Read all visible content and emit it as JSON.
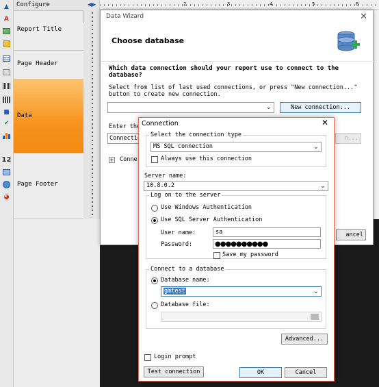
{
  "designer": {
    "configure_label": "Configure",
    "bands": [
      "Report Title",
      "Page Header",
      "Data",
      "Page Footer"
    ],
    "tools": [
      "pointer-icon",
      "text-icon",
      "picture-icon",
      "shape-icon",
      "table-icon",
      "image-icon",
      "barcode-icon",
      "check-icon",
      "chart-icon"
    ],
    "number_label": "12",
    "ruler_marks": [
      "1",
      "2",
      "3",
      "4",
      "5",
      "6"
    ]
  },
  "wizard": {
    "title": "Data Wizard",
    "close_glyph": "✕",
    "header": "Choose database",
    "question": "Which data connection should your report use to connect to the database?",
    "select_text": "Select from list of last used connections, or press \"New connection...\" button to create new connection.",
    "new_connection_label": "New connection...",
    "enter_text": "Enter the",
    "conn_field_value": "Connectio",
    "ghost_button_label": "n...",
    "conn_tree_label": "Conne",
    "cancel_label": "ancel"
  },
  "connection": {
    "title": "Connection",
    "close_glyph": "✕",
    "type_group_label": "Select the connection type",
    "type_value": "MS SQL connection",
    "always_use_label": "Always use this connection",
    "server_name_label": "Server name:",
    "server_name_value": "10.8.0.2",
    "logon_group_label": "Log on to the server",
    "windows_auth_label": "Use Windows Authentication",
    "sql_auth_label": "Use SQL Server Authentication",
    "username_label": "User name:",
    "username_value": "sa",
    "password_label": "Password:",
    "password_mask": "●●●●●●●●●●",
    "save_password_label": "Save my password",
    "db_group_label": "Connect to a database",
    "db_name_radio_label": "Database name:",
    "db_name_value": "gmtest",
    "db_file_radio_label": "Database file:",
    "advanced_label": "Advanced...",
    "login_prompt_label": "Login prompt",
    "test_label": "Test connection",
    "ok_label": "OK",
    "cancel_label": "Cancel"
  }
}
